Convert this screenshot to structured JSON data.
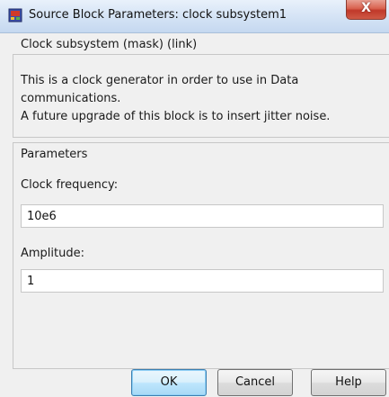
{
  "window": {
    "title": "Source Block Parameters: clock subsystem1",
    "close_label": "X"
  },
  "description": {
    "group_title": "Clock subsystem  (mask) (link)",
    "lines": [
      "This is a clock generator in order to use in Data",
      "communications.",
      "A future upgrade of this block is to insert jitter noise."
    ]
  },
  "parameters": {
    "title": "Parameters",
    "fields": [
      {
        "label": "Clock frequency:",
        "value": "10e6"
      },
      {
        "label": "Amplitude:",
        "value": "1"
      }
    ]
  },
  "buttons": {
    "ok": "OK",
    "cancel": "Cancel",
    "help": "Help"
  },
  "colors": {
    "close_button": "#c7402f",
    "dialog_background": "#f0f0f0",
    "default_button_border": "#3c7fb1"
  },
  "icons": {
    "app": "simulink-block-icon",
    "close": "close-icon"
  }
}
